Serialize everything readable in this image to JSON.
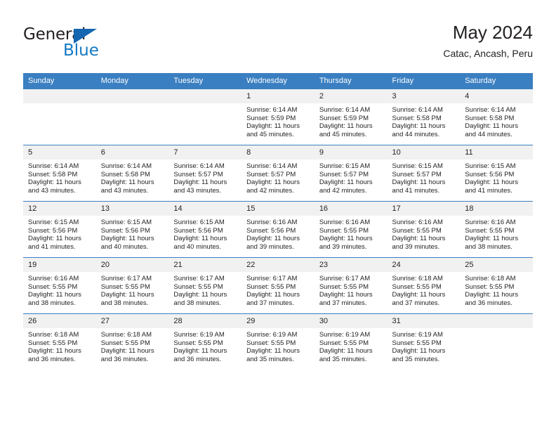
{
  "brand": {
    "name_top": "General",
    "name_bottom": "Blue",
    "triangle_color": "#1566b0",
    "blue_color": "#1479c4"
  },
  "header": {
    "title": "May 2024",
    "subtitle": "Catac, Ancash, Peru"
  },
  "theme": {
    "header_blue": "#3a7fc1",
    "daynum_bg": "#f1f1f1",
    "text": "#231f20"
  },
  "calendar": {
    "weekday_headers": [
      "Sunday",
      "Monday",
      "Tuesday",
      "Wednesday",
      "Thursday",
      "Friday",
      "Saturday"
    ],
    "weeks": [
      [
        {
          "day": "",
          "blank": true
        },
        {
          "day": "",
          "blank": true
        },
        {
          "day": "",
          "blank": true
        },
        {
          "day": "1",
          "sunrise": "Sunrise: 6:14 AM",
          "sunset": "Sunset: 5:59 PM",
          "daylight1": "Daylight: 11 hours",
          "daylight2": "and 45 minutes."
        },
        {
          "day": "2",
          "sunrise": "Sunrise: 6:14 AM",
          "sunset": "Sunset: 5:59 PM",
          "daylight1": "Daylight: 11 hours",
          "daylight2": "and 45 minutes."
        },
        {
          "day": "3",
          "sunrise": "Sunrise: 6:14 AM",
          "sunset": "Sunset: 5:58 PM",
          "daylight1": "Daylight: 11 hours",
          "daylight2": "and 44 minutes."
        },
        {
          "day": "4",
          "sunrise": "Sunrise: 6:14 AM",
          "sunset": "Sunset: 5:58 PM",
          "daylight1": "Daylight: 11 hours",
          "daylight2": "and 44 minutes."
        }
      ],
      [
        {
          "day": "5",
          "sunrise": "Sunrise: 6:14 AM",
          "sunset": "Sunset: 5:58 PM",
          "daylight1": "Daylight: 11 hours",
          "daylight2": "and 43 minutes."
        },
        {
          "day": "6",
          "sunrise": "Sunrise: 6:14 AM",
          "sunset": "Sunset: 5:58 PM",
          "daylight1": "Daylight: 11 hours",
          "daylight2": "and 43 minutes."
        },
        {
          "day": "7",
          "sunrise": "Sunrise: 6:14 AM",
          "sunset": "Sunset: 5:57 PM",
          "daylight1": "Daylight: 11 hours",
          "daylight2": "and 43 minutes."
        },
        {
          "day": "8",
          "sunrise": "Sunrise: 6:14 AM",
          "sunset": "Sunset: 5:57 PM",
          "daylight1": "Daylight: 11 hours",
          "daylight2": "and 42 minutes."
        },
        {
          "day": "9",
          "sunrise": "Sunrise: 6:15 AM",
          "sunset": "Sunset: 5:57 PM",
          "daylight1": "Daylight: 11 hours",
          "daylight2": "and 42 minutes."
        },
        {
          "day": "10",
          "sunrise": "Sunrise: 6:15 AM",
          "sunset": "Sunset: 5:57 PM",
          "daylight1": "Daylight: 11 hours",
          "daylight2": "and 41 minutes."
        },
        {
          "day": "11",
          "sunrise": "Sunrise: 6:15 AM",
          "sunset": "Sunset: 5:56 PM",
          "daylight1": "Daylight: 11 hours",
          "daylight2": "and 41 minutes."
        }
      ],
      [
        {
          "day": "12",
          "sunrise": "Sunrise: 6:15 AM",
          "sunset": "Sunset: 5:56 PM",
          "daylight1": "Daylight: 11 hours",
          "daylight2": "and 41 minutes."
        },
        {
          "day": "13",
          "sunrise": "Sunrise: 6:15 AM",
          "sunset": "Sunset: 5:56 PM",
          "daylight1": "Daylight: 11 hours",
          "daylight2": "and 40 minutes."
        },
        {
          "day": "14",
          "sunrise": "Sunrise: 6:15 AM",
          "sunset": "Sunset: 5:56 PM",
          "daylight1": "Daylight: 11 hours",
          "daylight2": "and 40 minutes."
        },
        {
          "day": "15",
          "sunrise": "Sunrise: 6:16 AM",
          "sunset": "Sunset: 5:56 PM",
          "daylight1": "Daylight: 11 hours",
          "daylight2": "and 39 minutes."
        },
        {
          "day": "16",
          "sunrise": "Sunrise: 6:16 AM",
          "sunset": "Sunset: 5:55 PM",
          "daylight1": "Daylight: 11 hours",
          "daylight2": "and 39 minutes."
        },
        {
          "day": "17",
          "sunrise": "Sunrise: 6:16 AM",
          "sunset": "Sunset: 5:55 PM",
          "daylight1": "Daylight: 11 hours",
          "daylight2": "and 39 minutes."
        },
        {
          "day": "18",
          "sunrise": "Sunrise: 6:16 AM",
          "sunset": "Sunset: 5:55 PM",
          "daylight1": "Daylight: 11 hours",
          "daylight2": "and 38 minutes."
        }
      ],
      [
        {
          "day": "19",
          "sunrise": "Sunrise: 6:16 AM",
          "sunset": "Sunset: 5:55 PM",
          "daylight1": "Daylight: 11 hours",
          "daylight2": "and 38 minutes."
        },
        {
          "day": "20",
          "sunrise": "Sunrise: 6:17 AM",
          "sunset": "Sunset: 5:55 PM",
          "daylight1": "Daylight: 11 hours",
          "daylight2": "and 38 minutes."
        },
        {
          "day": "21",
          "sunrise": "Sunrise: 6:17 AM",
          "sunset": "Sunset: 5:55 PM",
          "daylight1": "Daylight: 11 hours",
          "daylight2": "and 38 minutes."
        },
        {
          "day": "22",
          "sunrise": "Sunrise: 6:17 AM",
          "sunset": "Sunset: 5:55 PM",
          "daylight1": "Daylight: 11 hours",
          "daylight2": "and 37 minutes."
        },
        {
          "day": "23",
          "sunrise": "Sunrise: 6:17 AM",
          "sunset": "Sunset: 5:55 PM",
          "daylight1": "Daylight: 11 hours",
          "daylight2": "and 37 minutes."
        },
        {
          "day": "24",
          "sunrise": "Sunrise: 6:18 AM",
          "sunset": "Sunset: 5:55 PM",
          "daylight1": "Daylight: 11 hours",
          "daylight2": "and 37 minutes."
        },
        {
          "day": "25",
          "sunrise": "Sunrise: 6:18 AM",
          "sunset": "Sunset: 5:55 PM",
          "daylight1": "Daylight: 11 hours",
          "daylight2": "and 36 minutes."
        }
      ],
      [
        {
          "day": "26",
          "sunrise": "Sunrise: 6:18 AM",
          "sunset": "Sunset: 5:55 PM",
          "daylight1": "Daylight: 11 hours",
          "daylight2": "and 36 minutes."
        },
        {
          "day": "27",
          "sunrise": "Sunrise: 6:18 AM",
          "sunset": "Sunset: 5:55 PM",
          "daylight1": "Daylight: 11 hours",
          "daylight2": "and 36 minutes."
        },
        {
          "day": "28",
          "sunrise": "Sunrise: 6:19 AM",
          "sunset": "Sunset: 5:55 PM",
          "daylight1": "Daylight: 11 hours",
          "daylight2": "and 36 minutes."
        },
        {
          "day": "29",
          "sunrise": "Sunrise: 6:19 AM",
          "sunset": "Sunset: 5:55 PM",
          "daylight1": "Daylight: 11 hours",
          "daylight2": "and 35 minutes."
        },
        {
          "day": "30",
          "sunrise": "Sunrise: 6:19 AM",
          "sunset": "Sunset: 5:55 PM",
          "daylight1": "Daylight: 11 hours",
          "daylight2": "and 35 minutes."
        },
        {
          "day": "31",
          "sunrise": "Sunrise: 6:19 AM",
          "sunset": "Sunset: 5:55 PM",
          "daylight1": "Daylight: 11 hours",
          "daylight2": "and 35 minutes."
        },
        {
          "day": "",
          "blank": true
        }
      ]
    ]
  }
}
